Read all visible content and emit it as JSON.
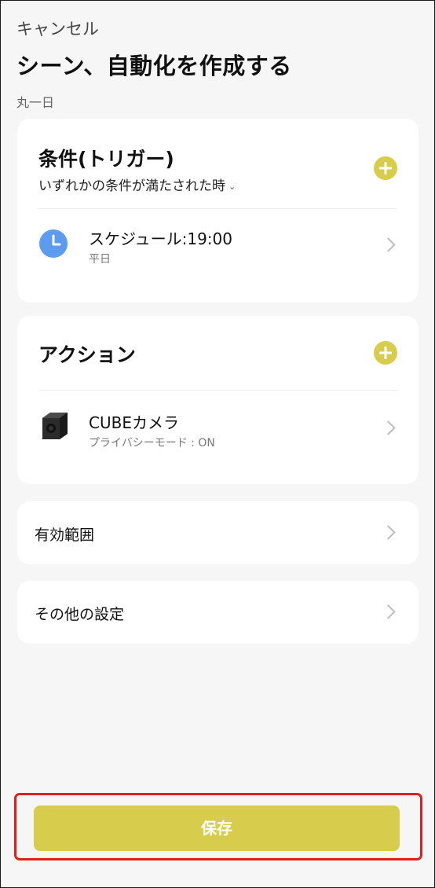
{
  "header": {
    "cancel_label": "キャンセル",
    "title": "シーン、自動化を作成する",
    "subtitle": "丸一日"
  },
  "conditions": {
    "title": "条件(トリガー)",
    "match_mode": "いずれかの条件が満たされた時",
    "items": [
      {
        "icon": "clock-icon",
        "title": "スケジュール:19:00",
        "subtitle": "平日"
      }
    ]
  },
  "actions": {
    "title": "アクション",
    "items": [
      {
        "icon": "camera-device-icon",
        "title": "CUBEカメラ",
        "subtitle": "プライバシーモード : ON"
      }
    ]
  },
  "settings_rows": {
    "scope_label": "有効範囲",
    "other_label": "その他の設定"
  },
  "footer": {
    "save_label": "保存"
  },
  "colors": {
    "accent": "#d8cc4c",
    "highlight_border": "#e02020",
    "clock_blue": "#5b9cf0",
    "background": "#f6f6f6"
  }
}
